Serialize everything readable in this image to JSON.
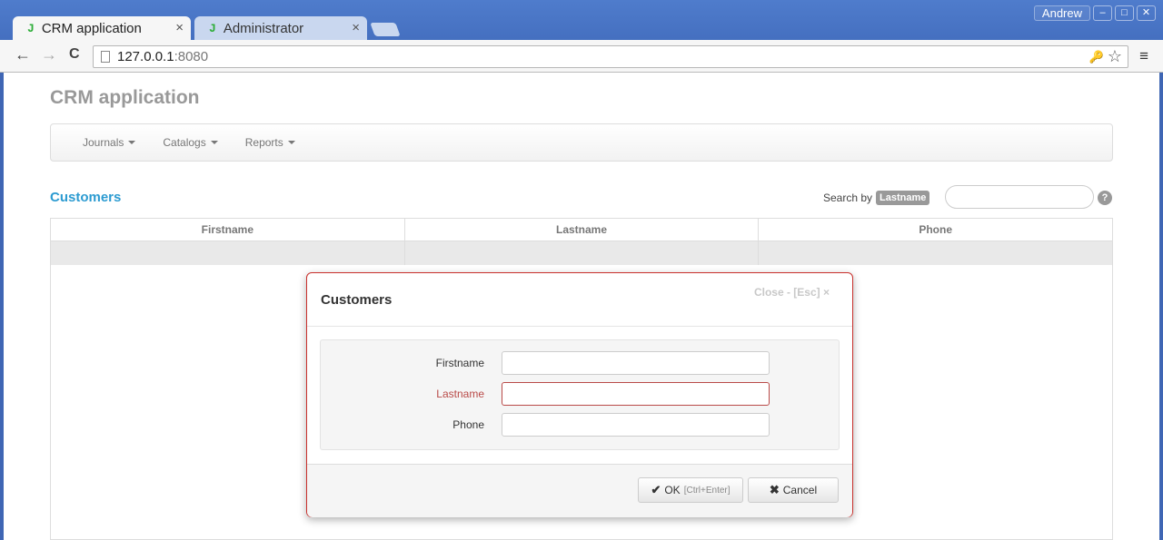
{
  "browser": {
    "tabs": [
      {
        "icon": "J",
        "label": "CRM application",
        "active": true
      },
      {
        "icon": "J",
        "label": "Administrator",
        "active": false
      }
    ],
    "tab_close": "×",
    "user": "Andrew",
    "window_controls": {
      "minimize": "–",
      "maximize": "□",
      "close": "✕"
    },
    "url_host": "127.0.0.1",
    "url_port": ":8080",
    "nav": {
      "back": "←",
      "forward": "→",
      "reload": "C"
    },
    "omni_icons": {
      "key": "🔑",
      "star": "☆"
    },
    "menu": "≡"
  },
  "app": {
    "title": "CRM application",
    "nav_items": [
      "Journals",
      "Catalogs",
      "Reports"
    ]
  },
  "customers": {
    "title": "Customers",
    "search_label": "Search by",
    "search_field": "Lastname",
    "search_placeholder": "",
    "help": "?",
    "columns": [
      "Firstname",
      "Lastname",
      "Phone"
    ]
  },
  "modal": {
    "title": "Customers",
    "close_label": "Close - [Esc] ×",
    "fields": [
      {
        "label": "Firstname",
        "value": "",
        "error": false
      },
      {
        "label": "Lastname",
        "value": "",
        "error": true
      },
      {
        "label": "Phone",
        "value": "",
        "error": false
      }
    ],
    "ok_label": "OK",
    "ok_hint": "[Ctrl+Enter]",
    "cancel_label": "Cancel",
    "ok_icon": "✔",
    "cancel_icon": "✖"
  },
  "colors": {
    "accent": "#2c9bd1",
    "error": "#b94a48",
    "chrome": "#3f66b4"
  }
}
